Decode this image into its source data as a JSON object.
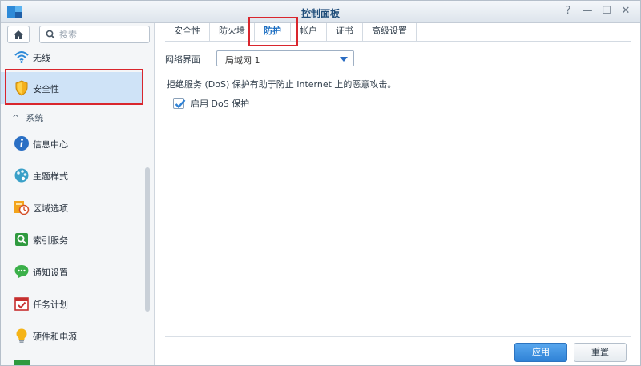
{
  "window": {
    "title": "控制面板",
    "controls": {
      "help": "?",
      "minimize": "—",
      "maximize": "☐",
      "close": "✕"
    }
  },
  "sidebar": {
    "search_placeholder": "搜索",
    "items": [
      {
        "label": "无线",
        "icon": "wifi-icon"
      },
      {
        "label": "安全性",
        "icon": "shield-icon",
        "selected": true
      },
      {
        "label": "信息中心",
        "icon": "info-icon"
      },
      {
        "label": "主题样式",
        "icon": "palette-icon"
      },
      {
        "label": "区域选项",
        "icon": "region-icon"
      },
      {
        "label": "索引服务",
        "icon": "index-search-icon"
      },
      {
        "label": "通知设置",
        "icon": "chat-bubble-icon"
      },
      {
        "label": "任务计划",
        "icon": "calendar-check-icon"
      },
      {
        "label": "硬件和电源",
        "icon": "bulb-icon"
      }
    ],
    "group": {
      "label": "系统",
      "expanded": true
    }
  },
  "main": {
    "tabs": [
      {
        "label": "安全性"
      },
      {
        "label": "防火墙"
      },
      {
        "label": "防护",
        "active": true
      },
      {
        "label": "帐户"
      },
      {
        "label": "证书"
      },
      {
        "label": "高级设置"
      }
    ],
    "network_label": "网络界面",
    "network_value": "局域网 1",
    "description": "拒绝服务 (DoS) 保护有助于防止 Internet 上的恶意攻击。",
    "dos_checkbox_label": "启用 DoS 保护",
    "dos_checked": true,
    "apply_label": "应用",
    "reset_label": "重置"
  },
  "colors": {
    "accent": "#2f82d6",
    "highlight_box": "#d9262d",
    "selected_bg": "#cfe3f7"
  }
}
